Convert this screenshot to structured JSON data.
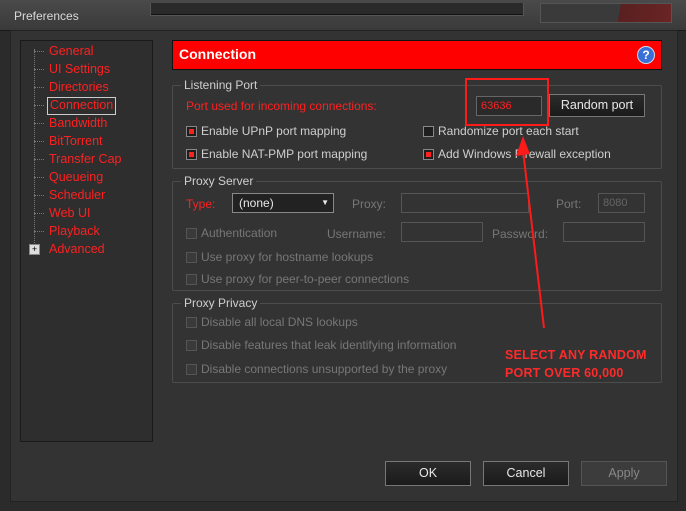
{
  "window": {
    "title": "Preferences"
  },
  "sidebar": {
    "items": [
      {
        "label": "General"
      },
      {
        "label": "UI Settings"
      },
      {
        "label": "Directories"
      },
      {
        "label": "Connection",
        "selected": true
      },
      {
        "label": "Bandwidth"
      },
      {
        "label": "BitTorrent"
      },
      {
        "label": "Transfer Cap"
      },
      {
        "label": "Queueing"
      },
      {
        "label": "Scheduler"
      },
      {
        "label": "Web UI"
      },
      {
        "label": "Playback"
      },
      {
        "label": "Advanced",
        "expandable": true
      }
    ]
  },
  "panel": {
    "title": "Connection",
    "help_icon": "question-mark-icon"
  },
  "listening_port": {
    "legend": "Listening Port",
    "port_label": "Port used for incoming connections:",
    "port_value": "63636",
    "random_port_button": "Random port",
    "upnp_label": "Enable UPnP port mapping",
    "upnp_checked": true,
    "natpmp_label": "Enable NAT-PMP port mapping",
    "natpmp_checked": true,
    "randomize_label": "Randomize port each start",
    "randomize_checked": false,
    "firewall_label": "Add Windows Firewall exception",
    "firewall_checked": true
  },
  "proxy_server": {
    "legend": "Proxy Server",
    "type_label": "Type:",
    "type_value": "(none)",
    "proxy_label": "Proxy:",
    "proxy_value": "",
    "port_label": "Port:",
    "port_value": "8080",
    "auth_label": "Authentication",
    "username_label": "Username:",
    "password_label": "Password:",
    "hostname_label": "Use proxy for hostname lookups",
    "p2p_label": "Use proxy for peer-to-peer connections"
  },
  "proxy_privacy": {
    "legend": "Proxy Privacy",
    "dns_label": "Disable all local DNS lookups",
    "leak_label": "Disable features that leak identifying information",
    "unsupported_label": "Disable connections unsupported by the proxy"
  },
  "annotation": {
    "line1": "SELECT ANY RANDOM",
    "line2": "PORT OVER 60,000",
    "color": "#ff2a2a"
  },
  "footer": {
    "ok": "OK",
    "cancel": "Cancel",
    "apply": "Apply"
  },
  "colors": {
    "accent": "#ff0000",
    "background": "#333333"
  }
}
